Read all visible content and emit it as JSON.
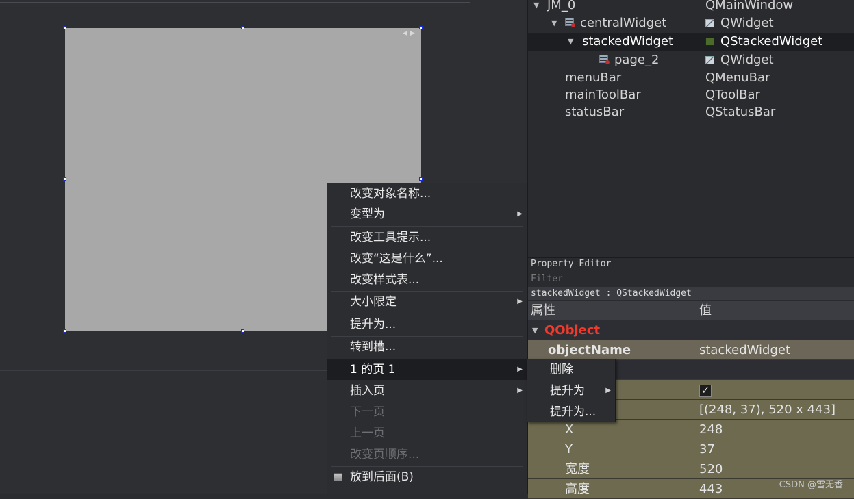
{
  "object_inspector": {
    "rows": [
      {
        "name": "JM_0",
        "class": "QMainWindow",
        "expanded": true
      },
      {
        "name": "centralWidget",
        "class": "QWidget",
        "expanded": true,
        "icon": "layout-icon"
      },
      {
        "name": "stackedWidget",
        "class": "QStackedWidget",
        "expanded": true,
        "selected": true
      },
      {
        "name": "page_2",
        "class": "QWidget",
        "icon": "layout-icon"
      },
      {
        "name": "menuBar",
        "class": "QMenuBar"
      },
      {
        "name": "mainToolBar",
        "class": "QToolBar"
      },
      {
        "name": "statusBar",
        "class": "QStatusBar"
      }
    ]
  },
  "property_editor": {
    "title": "Property Editor",
    "filter_placeholder": "Filter",
    "object_label": "stackedWidget : QStackedWidget",
    "col_property": "属性",
    "col_value": "值",
    "group": "QObject",
    "rows": [
      {
        "key": "objectName",
        "value": "stackedWidget"
      },
      {
        "key": "",
        "value": ""
      },
      {
        "key": "",
        "value": "✓"
      },
      {
        "key": "",
        "value": "[(248, 37), 520 x 443]"
      },
      {
        "key": "X",
        "value": "248"
      },
      {
        "key": "Y",
        "value": "37"
      },
      {
        "key": "宽度",
        "value": "520"
      },
      {
        "key": "高度",
        "value": "443"
      }
    ]
  },
  "context_menu": {
    "items": [
      {
        "label": "改变对象名称..."
      },
      {
        "label": "变型为",
        "submenu": true
      },
      {
        "label": "改变工具提示..."
      },
      {
        "label": "改变“这是什么”..."
      },
      {
        "label": "改变样式表..."
      },
      {
        "label": "大小限定",
        "submenu": true
      },
      {
        "label": "提升为..."
      },
      {
        "label": "转到槽..."
      },
      {
        "label": "1 的页 1",
        "submenu": true,
        "active": true
      },
      {
        "label": "插入页",
        "submenu": true
      },
      {
        "label": "下一页",
        "disabled": true
      },
      {
        "label": "上一页",
        "disabled": true
      },
      {
        "label": "改变页顺序...",
        "disabled": true
      },
      {
        "label": "放到后面(B)"
      }
    ]
  },
  "submenu": {
    "items": [
      {
        "label": "删除"
      },
      {
        "label": "提升为",
        "submenu": true
      },
      {
        "label": "提升为..."
      }
    ]
  },
  "watermark": "CSDN @雪无香",
  "colors": {
    "background": "#2b2c30",
    "widget_gray": "#a8a8a8",
    "selection_handle": "#1a2ed8",
    "qobject_red": "#ee3b2e",
    "property_highlight": "#6c6658"
  }
}
